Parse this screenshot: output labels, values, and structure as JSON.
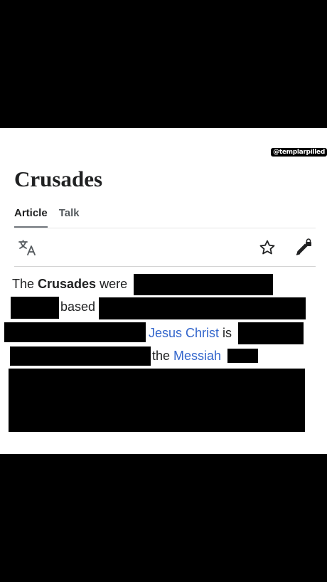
{
  "watermark": "@templarpilled",
  "article": {
    "title": "Crusades",
    "tabs": [
      {
        "label": "Article",
        "active": true
      },
      {
        "label": "Talk",
        "active": false
      }
    ]
  },
  "toolbar": {
    "icons": [
      "language-icon",
      "star-icon",
      "edit-lock-icon"
    ]
  },
  "body": {
    "line1": {
      "text_before": "The ",
      "bold": "Crusades",
      "text_after": " were"
    },
    "line2": {
      "text": "based"
    },
    "line3": {
      "link": "Jesus Christ",
      "text_after": " is"
    },
    "line4": {
      "text": "the ",
      "link": "Messiah"
    }
  },
  "colors": {
    "link": "#3366cc",
    "text": "#202122",
    "redaction": "#000000"
  }
}
